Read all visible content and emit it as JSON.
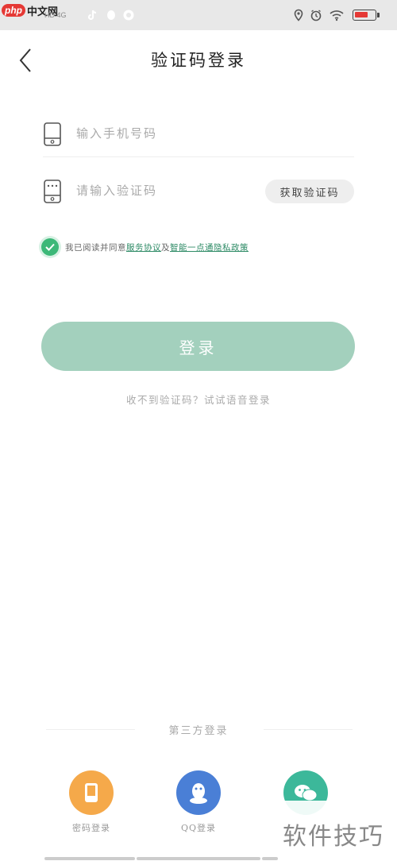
{
  "status_bar": {
    "logo_php": "php",
    "logo_cn": "中文网",
    "left_extra": "HD 4G"
  },
  "header": {
    "title": "验证码登录"
  },
  "form": {
    "phone_placeholder": "输入手机号码",
    "code_placeholder": "请输入验证码",
    "get_code_label": "获取验证码"
  },
  "agreement": {
    "prefix": "我已阅读并同意",
    "link1": "服务协议",
    "middle": "及",
    "link2": "智能一点通隐私政策"
  },
  "login": {
    "button_label": "登录",
    "no_code_link": "收不到验证码？试试语音登录"
  },
  "third_party": {
    "title": "第三方登录",
    "items": [
      {
        "label": "密码登录",
        "color": "#f5a94a",
        "icon": "phone-icon"
      },
      {
        "label": "QQ登录",
        "color": "#4a7fd6",
        "icon": "qq-penguin-icon"
      },
      {
        "label": "",
        "color": "#3cb89a",
        "icon": "wechat-icon"
      }
    ]
  },
  "watermark": {
    "text": "软件技巧"
  },
  "colors": {
    "accent": "#3cb878",
    "login_button": "#a3d0bd",
    "link": "#2e8b66"
  }
}
